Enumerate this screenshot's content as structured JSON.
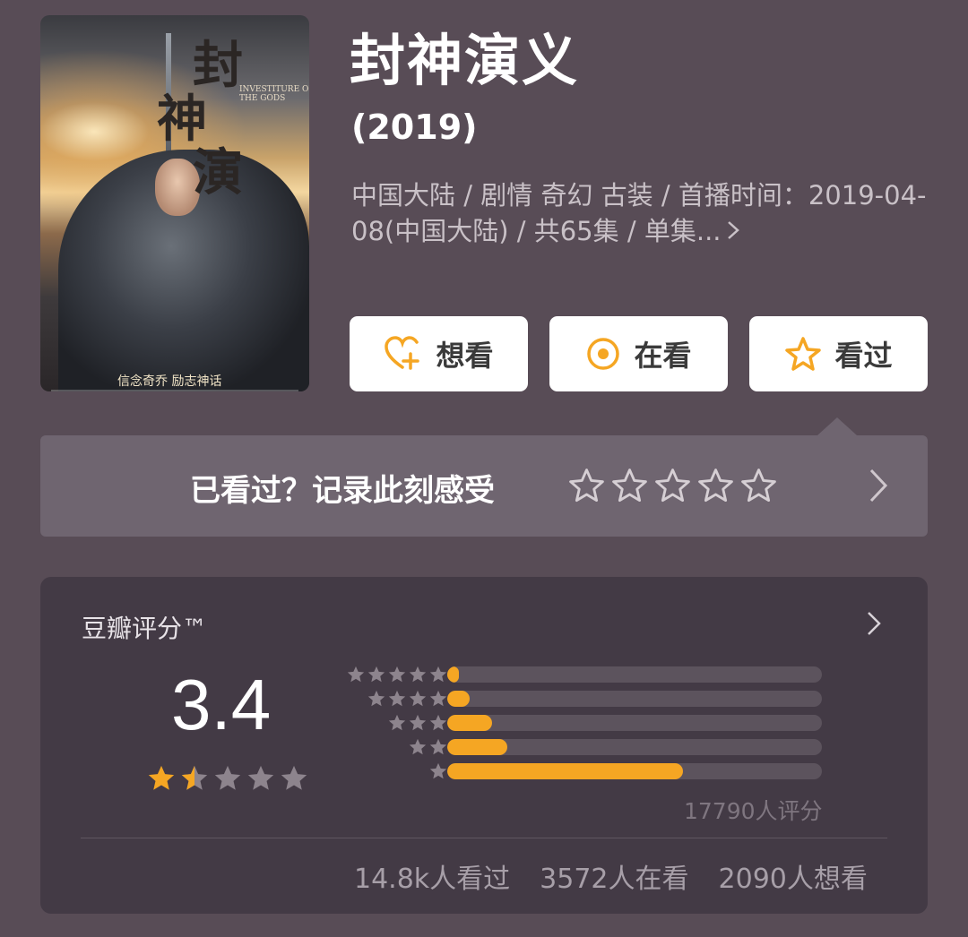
{
  "show": {
    "title": "封神演义",
    "year": "(2019)",
    "meta": "中国大陆 / 剧情 奇幻 古装 / 首播时间：2019-04-08(中国大陆) / 共65集 / 单集..."
  },
  "poster": {
    "title_calligraphy": [
      "封",
      "神",
      "演"
    ],
    "english_title": "INVESTITURE OF THE GODS",
    "slogan": "信念奇乔   励志神话"
  },
  "actions": [
    {
      "label": "想看",
      "icon": "heart-plus-icon"
    },
    {
      "label": "在看",
      "icon": "target-circle-icon"
    },
    {
      "label": "看过",
      "icon": "star-outline-icon"
    }
  ],
  "rate_prompt": {
    "text": "已看过？记录此刻感受",
    "star_count": 5
  },
  "rating": {
    "label": "豆瓣评分™",
    "score": "3.4",
    "stars_value": 1.5,
    "stars_max": 5,
    "rating_count": "17790人评分",
    "distribution": [
      {
        "stars": 5,
        "percent": 3
      },
      {
        "stars": 4,
        "percent": 6
      },
      {
        "stars": 3,
        "percent": 12
      },
      {
        "stars": 2,
        "percent": 16
      },
      {
        "stars": 1,
        "percent": 63
      }
    ],
    "stats": [
      "14.8k人看过",
      "3572人在看",
      "2090人想看"
    ]
  },
  "colors": {
    "background": "#584c56",
    "accent": "#f5a623",
    "card": "#433a45",
    "rate_card": "#6f6570"
  }
}
